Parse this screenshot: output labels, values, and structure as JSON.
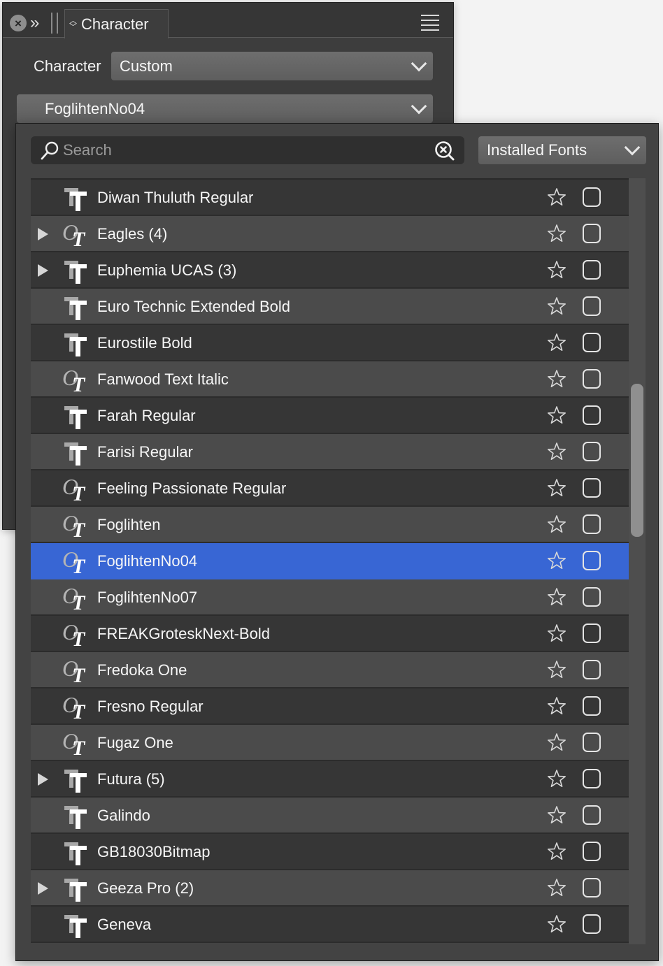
{
  "panel": {
    "tab_label": "Character",
    "icons": [
      "close-icon",
      "collapse-icon",
      "grip-icon",
      "updown-icon",
      "hamburger-menu-icon"
    ],
    "character_label": "Character",
    "character_style_value": "Custom",
    "font_family_value": "FoglihtenNo04"
  },
  "popup": {
    "search_placeholder": "Search",
    "search_value": "",
    "source_value": "Installed Fonts",
    "selection_color": "#3866d4",
    "scroll": {
      "thumb_start_fraction": 0.268,
      "thumb_size_fraction": 0.2
    },
    "fonts": [
      {
        "name": "Diwan Thuluth Regular",
        "type": "truetype",
        "expandable": false,
        "selected": false
      },
      {
        "name": "Eagles (4)",
        "type": "opentype",
        "expandable": true,
        "selected": false
      },
      {
        "name": "Euphemia UCAS (3)",
        "type": "truetype",
        "expandable": true,
        "selected": false
      },
      {
        "name": "Euro Technic Extended Bold",
        "type": "truetype",
        "expandable": false,
        "selected": false
      },
      {
        "name": "Eurostile Bold",
        "type": "truetype",
        "expandable": false,
        "selected": false
      },
      {
        "name": "Fanwood Text Italic",
        "type": "opentype",
        "expandable": false,
        "selected": false
      },
      {
        "name": "Farah Regular",
        "type": "truetype",
        "expandable": false,
        "selected": false
      },
      {
        "name": "Farisi Regular",
        "type": "truetype",
        "expandable": false,
        "selected": false
      },
      {
        "name": "Feeling Passionate Regular",
        "type": "opentype",
        "expandable": false,
        "selected": false
      },
      {
        "name": "Foglihten",
        "type": "opentype",
        "expandable": false,
        "selected": false
      },
      {
        "name": "FoglihtenNo04",
        "type": "opentype",
        "expandable": false,
        "selected": true
      },
      {
        "name": "FoglihtenNo07",
        "type": "opentype",
        "expandable": false,
        "selected": false
      },
      {
        "name": "FREAKGroteskNext-Bold",
        "type": "opentype",
        "expandable": false,
        "selected": false
      },
      {
        "name": "Fredoka One",
        "type": "opentype",
        "expandable": false,
        "selected": false
      },
      {
        "name": "Fresno Regular",
        "type": "opentype",
        "expandable": false,
        "selected": false
      },
      {
        "name": "Fugaz One",
        "type": "opentype",
        "expandable": false,
        "selected": false
      },
      {
        "name": "Futura (5)",
        "type": "truetype",
        "expandable": true,
        "selected": false
      },
      {
        "name": "Galindo",
        "type": "truetype",
        "expandable": false,
        "selected": false
      },
      {
        "name": "GB18030Bitmap",
        "type": "truetype",
        "expandable": false,
        "selected": false
      },
      {
        "name": "Geeza Pro (2)",
        "type": "truetype",
        "expandable": true,
        "selected": false
      },
      {
        "name": "Geneva",
        "type": "truetype",
        "expandable": false,
        "selected": false
      }
    ]
  }
}
